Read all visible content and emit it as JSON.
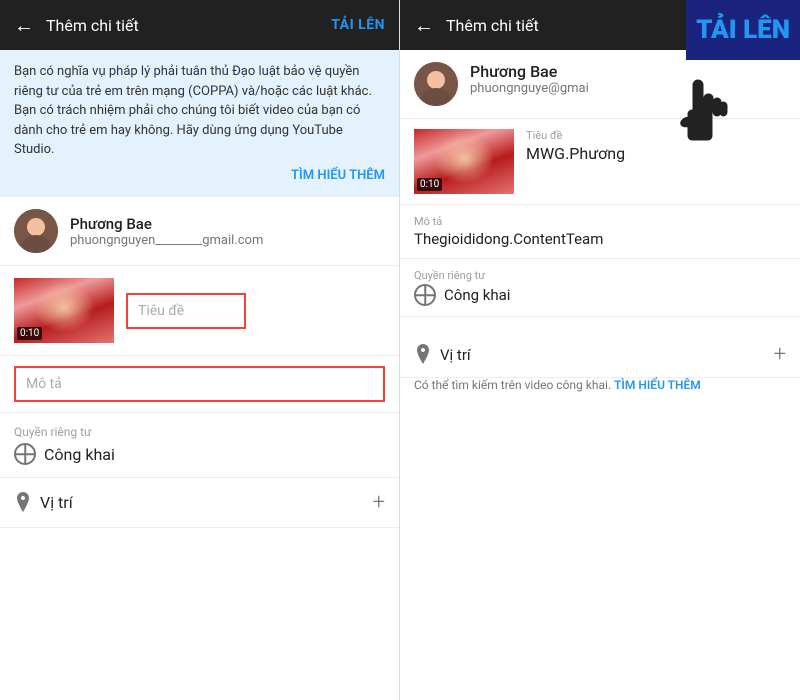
{
  "left": {
    "header": {
      "arrow": "←",
      "title": "Thêm chi tiết",
      "upload": "TẢI LÊN"
    },
    "notice": {
      "text": "Bạn có nghĩa vụ pháp lý phải tuân thủ Đạo luật bảo vệ quyền riêng tư của trẻ em trên mạng (COPPA) và/hoặc các luật khác. Bạn có trách nhiệm phải cho chúng tôi biết video của bạn có dành cho trẻ em hay không. Hãy dùng ứng dụng YouTube Studio.",
      "link": "TÌM HIỂU THÊM"
    },
    "user": {
      "name": "Phương Bae",
      "email": "phuongnguyen________gmail.com"
    },
    "video": {
      "duration": "0:10",
      "title_placeholder": "Tiêu đề"
    },
    "description_placeholder": "Mô tả",
    "privacy_label": "Quyền riêng tư",
    "privacy_value": "Công khai",
    "location_label": "Vị trí",
    "plus": "+"
  },
  "right": {
    "header": {
      "arrow": "←",
      "title": "Thêm chi tiết",
      "upload": "TẢI LÊN"
    },
    "user": {
      "name": "Phương Bae",
      "email_prefix": "phuongnguye",
      "email_suffix": "@gmai"
    },
    "video": {
      "duration": "0:10",
      "title_label": "Tiêu đề",
      "title_value": "MWG.Phương"
    },
    "description_label": "Mô tả",
    "description_value": "Thegioididong.ContentTeam",
    "privacy_label": "Quyền riêng tư",
    "privacy_value": "Công khai",
    "location_label": "Vị trí",
    "location_hint": "Có thể tìm kiếm trên video công khai.",
    "location_hint_link": "TÌM HIỂU THÊM",
    "plus": "+"
  }
}
